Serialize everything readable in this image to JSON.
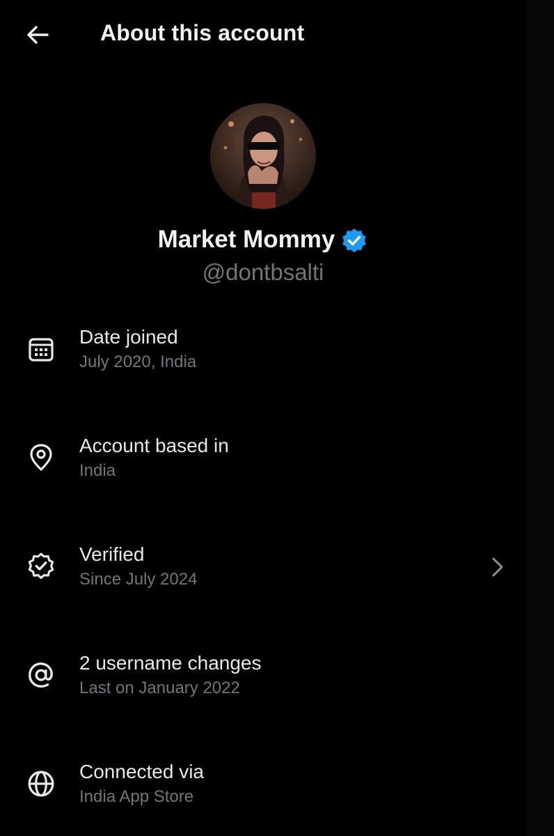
{
  "header": {
    "title": "About this account",
    "back_icon": "arrow-left-icon"
  },
  "profile": {
    "display_name": "Market Mommy",
    "handle": "@dontbsalti",
    "verified_badge_color": "#1d9bf0"
  },
  "info": [
    {
      "icon": "calendar-icon",
      "label": "Date joined",
      "sub": "July 2020, India"
    },
    {
      "icon": "location-pin-icon",
      "label": "Account based in",
      "sub": "India"
    },
    {
      "icon": "verified-check-icon",
      "label": "Verified",
      "sub": "Since July 2024",
      "chevron": "chevron-right-icon"
    },
    {
      "icon": "at-sign-icon",
      "label": "2 username changes",
      "sub": "Last on January 2022"
    },
    {
      "icon": "globe-icon",
      "label": "Connected via",
      "sub": "India App Store"
    }
  ],
  "colors": {
    "background": "#000000",
    "primary_text": "#e7e9ea",
    "secondary_text": "#71767b",
    "accent": "#1d9bf0"
  }
}
